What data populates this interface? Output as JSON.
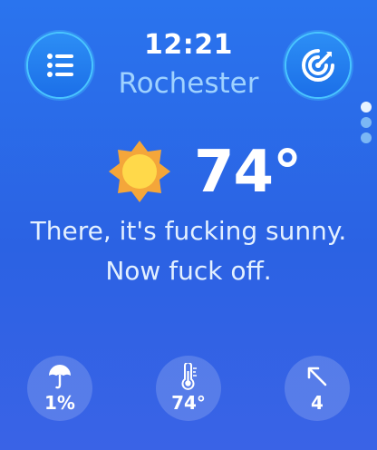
{
  "header": {
    "time": "12:21",
    "city": "Rochester"
  },
  "buttons": {
    "menu_icon": "list-icon",
    "radar_icon": "radar-icon"
  },
  "pager": {
    "pages": 3,
    "active_index": 0
  },
  "current": {
    "condition_icon": "sun-icon",
    "temperature": "74°",
    "message": "There, it's fucking sunny. Now fuck off."
  },
  "stats": {
    "precipitation": {
      "icon": "umbrella-icon",
      "value": "1%"
    },
    "feels_like": {
      "icon": "thermometer-icon",
      "value": "74°"
    },
    "wind": {
      "icon": "wind-direction-arrow-icon",
      "value": "4"
    }
  },
  "colors": {
    "background_top": "#2a74ee",
    "background_bottom": "#3a63e6",
    "button_ring": "#49c6ff",
    "city_text": "#9fd2ff",
    "sun_fill": "#ffd94a",
    "sun_rays": "#f4a63a"
  }
}
